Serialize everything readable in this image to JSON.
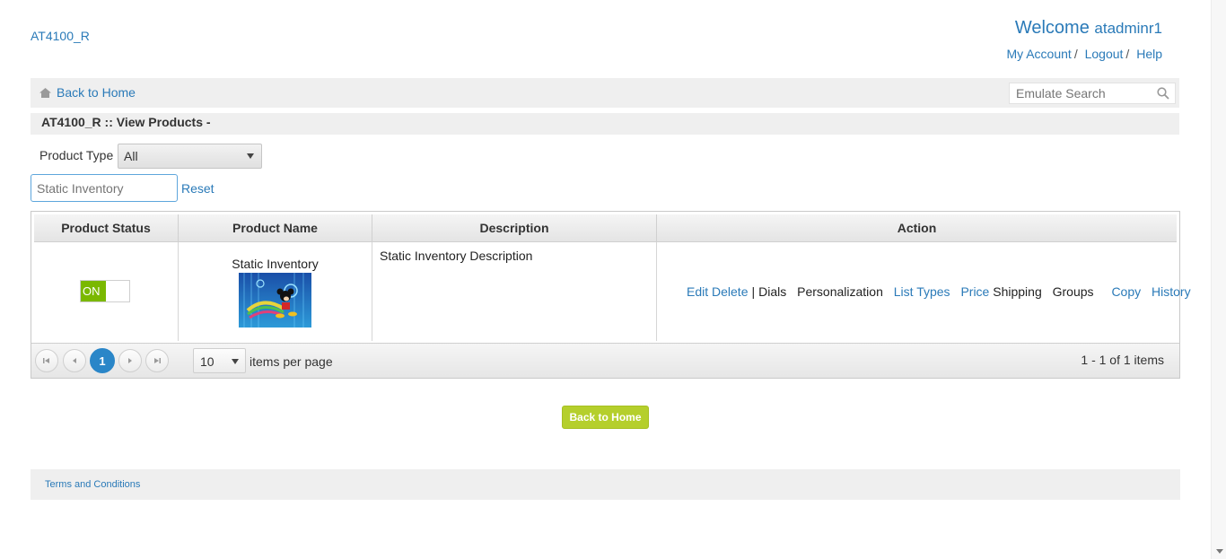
{
  "header": {
    "store_code": "AT4100_R",
    "welcome_label": "Welcome",
    "username": "atadminr1",
    "links": {
      "my_account": "My Account",
      "logout": "Logout",
      "help": "Help",
      "separator": "/"
    }
  },
  "nav": {
    "back_home": "Back to Home",
    "emulate_placeholder": "Emulate Search"
  },
  "page": {
    "title": "AT4100_R :: View Products -"
  },
  "filters": {
    "product_type_label": "Product Type :",
    "product_type_value": "All",
    "search_placeholder": "Static Inventory",
    "reset": "Reset"
  },
  "grid": {
    "columns": [
      "Product Status",
      "Product Name",
      "Description",
      "Action"
    ],
    "rows": [
      {
        "status": "ON",
        "name": "Static Inventory",
        "description": "Static Inventory Description",
        "actions": {
          "edit": "Edit",
          "delete": "Delete",
          "separator": "|",
          "dials": "Dials",
          "personalization": "Personalization",
          "list_types": "List Types",
          "price": "Price",
          "shipping": "Shipping",
          "groups": "Groups",
          "copy": "Copy",
          "history": "History"
        }
      }
    ],
    "pager": {
      "current_page": "1",
      "page_size": "10",
      "per_page_label": "items per page",
      "info": "1 - 1 of 1 items"
    }
  },
  "back_button": "Back to Home",
  "footer": {
    "terms": "Terms and Conditions"
  },
  "colors": {
    "link": "#2a7ab8",
    "toggle_on": "#7ab800",
    "button": "#b5cf2c",
    "active_page": "#2a86c8"
  }
}
